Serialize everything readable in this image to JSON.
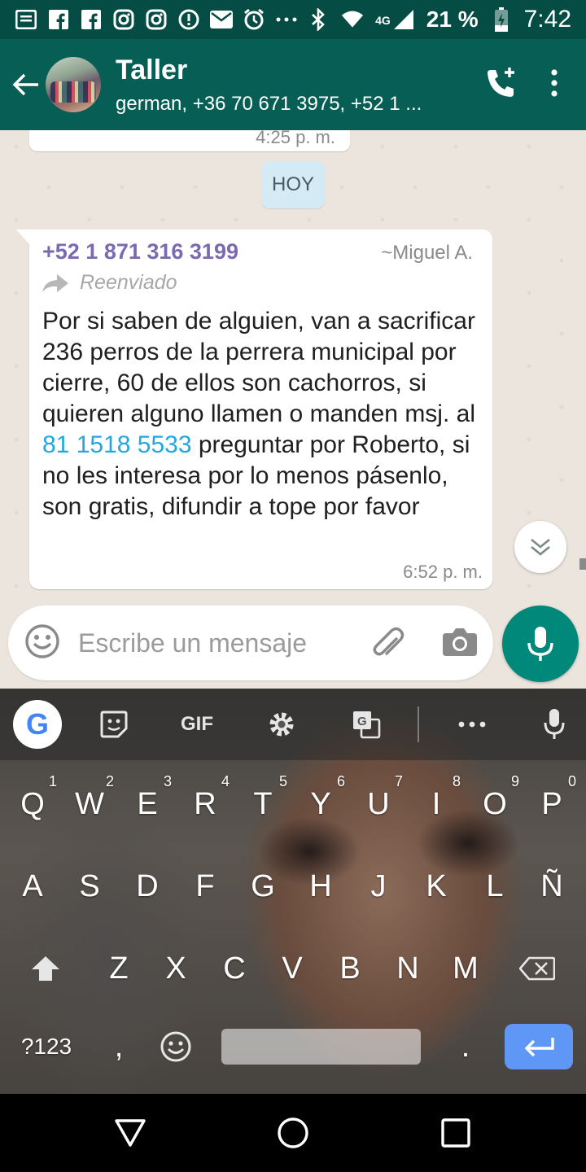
{
  "status_bar": {
    "icons": [
      "notes-icon",
      "facebook-icon",
      "facebook-icon",
      "instagram-icon",
      "instagram-icon",
      "alert-icon",
      "mail-icon",
      "alarm-icon",
      "more-icon",
      "bluetooth-icon",
      "wifi-icon",
      "signal-icon"
    ],
    "network": "4G",
    "battery": "21 %",
    "time": "7:42"
  },
  "header": {
    "title": "Taller",
    "subtitle": "german, +36 70 671 3975, +52 1 ..."
  },
  "chat": {
    "prev_time": "4:25 p. m.",
    "date_chip": "HOY",
    "message": {
      "sender_number": "+52 1 871 316 3199",
      "sender_name": "~Miguel A.",
      "forwarded_label": "Reenviado",
      "text_part1": "Por si saben de alguien, van a sacrificar 236 perros de la perrera municipal por cierre, 60 de ellos son cachorros, si quieren alguno llamen o manden msj. al ",
      "link_phone": "81 1518 5533",
      "text_part2": " preguntar por Roberto, si no les interesa por lo menos pásenlo, son gratis, difundir a tope por favor",
      "time": "6:52 p. m."
    }
  },
  "input": {
    "placeholder": "Escribe un mensaje"
  },
  "keyboard": {
    "toolbar": {
      "google": "G",
      "gif": "GIF"
    },
    "row1": [
      {
        "key": "Q",
        "hint": "1"
      },
      {
        "key": "W",
        "hint": "2"
      },
      {
        "key": "E",
        "hint": "3"
      },
      {
        "key": "R",
        "hint": "4"
      },
      {
        "key": "T",
        "hint": "5"
      },
      {
        "key": "Y",
        "hint": "6"
      },
      {
        "key": "U",
        "hint": "7"
      },
      {
        "key": "I",
        "hint": "8"
      },
      {
        "key": "O",
        "hint": "9"
      },
      {
        "key": "P",
        "hint": "0"
      }
    ],
    "row2": [
      "A",
      "S",
      "D",
      "F",
      "G",
      "H",
      "J",
      "K",
      "L",
      "Ñ"
    ],
    "row3": [
      "Z",
      "X",
      "C",
      "V",
      "B",
      "N",
      "M"
    ],
    "symbols": "?123",
    "comma": ",",
    "period": "."
  },
  "colors": {
    "status_bar": "#054d44",
    "app_bar": "#075e54",
    "chat_bg": "#ece5dd",
    "sender": "#7b6ab0",
    "link": "#22a7de",
    "mic": "#00897b",
    "enter": "#5e97f6"
  }
}
